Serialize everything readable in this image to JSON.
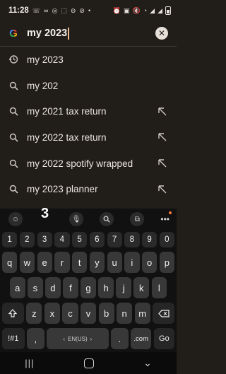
{
  "status": {
    "time": "11:28"
  },
  "search": {
    "query": "my 2023"
  },
  "suggestions": [
    {
      "text": "my 2023",
      "type": "history",
      "fill": false
    },
    {
      "text": "my 202",
      "type": "search",
      "fill": false
    },
    {
      "text": "my 2021 tax return",
      "type": "search",
      "fill": true
    },
    {
      "text": "my 2022 tax return",
      "type": "search",
      "fill": true
    },
    {
      "text": "my 2022 spotify wrapped",
      "type": "search",
      "fill": true
    },
    {
      "text": "my 2023 planner",
      "type": "search",
      "fill": true
    }
  ],
  "keyboard": {
    "preview_digit": "3",
    "numbers": [
      "1",
      "2",
      "3",
      "4",
      "5",
      "6",
      "7",
      "8",
      "9",
      "0"
    ],
    "row1": [
      "q",
      "w",
      "e",
      "r",
      "t",
      "y",
      "u",
      "i",
      "o",
      "p"
    ],
    "row2": [
      "a",
      "s",
      "d",
      "f",
      "g",
      "h",
      "j",
      "k",
      "l"
    ],
    "row3": [
      "z",
      "x",
      "c",
      "v",
      "b",
      "n",
      "m"
    ],
    "symbols_label": "!#1",
    "comma": ",",
    "space_label": "EN(US)",
    "period": ".",
    "dotcom": ".com",
    "go_label": "Go"
  }
}
